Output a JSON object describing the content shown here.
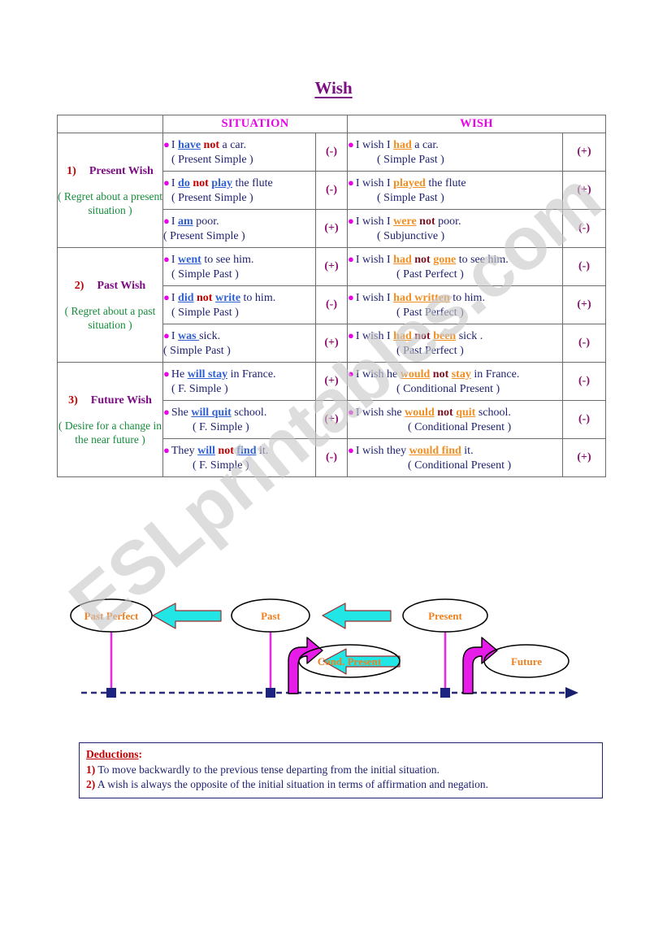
{
  "title": "Wish",
  "watermark": "ESLprintables.com",
  "table": {
    "headers": {
      "blank": "",
      "situation": "SITUATION",
      "wish": "WISH"
    },
    "sections": [
      {
        "num": "1)",
        "name": "Present Wish",
        "desc": "( Regret about a present situation )",
        "rows": [
          {
            "situation": {
              "pre": "I ",
              "verb": "have",
              "mid": " ",
              "neg": "not",
              "post": " a car."
            },
            "situation_tense": "( Present Simple )",
            "situation_sign": "(-)",
            "wish": {
              "pre": "I wish I ",
              "verb": "had",
              "mid": "",
              "neg": "",
              "post": " a car."
            },
            "wish_tense": "( Simple Past )",
            "wish_sign": "(+)"
          },
          {
            "situation": {
              "pre": "I ",
              "verb": "do",
              "mid": " ",
              "neg": "not",
              "post": " ",
              "verb2": "play",
              "post2": " the flute"
            },
            "situation_tense": "( Present Simple )",
            "situation_sign": "(-)",
            "wish": {
              "pre": "I wish I ",
              "verb": "played",
              "mid": "",
              "neg": "",
              "post": " the flute"
            },
            "wish_tense": "( Simple Past )",
            "wish_sign": "(+)"
          },
          {
            "situation": {
              "pre": "I ",
              "verb": "am",
              "mid": "",
              "neg": "",
              "post": " poor."
            },
            "situation_tense": "( Present Simple )",
            "situation_sign": "(+)",
            "wish": {
              "pre": "I wish I ",
              "verb": "were",
              "mid": " ",
              "neg": "not",
              "post": " poor."
            },
            "wish_tense": "( Subjunctive )",
            "wish_sign": "(-)"
          }
        ]
      },
      {
        "num": "2)",
        "name": "Past Wish",
        "desc": "( Regret about a past situation )",
        "rows": [
          {
            "situation": {
              "pre": "I ",
              "verb": "went",
              "mid": "",
              "neg": "",
              "post": " to see him."
            },
            "situation_tense": "( Simple Past )",
            "situation_sign": "(+)",
            "wish": {
              "pre": "I wish I ",
              "verb": "had",
              "mid": " ",
              "neg": "not",
              "post": " ",
              "verb2": "gone",
              "post2": " to see him."
            },
            "wish_tense": "( Past Perfect )",
            "wish_sign": "(-)"
          },
          {
            "situation": {
              "pre": "I ",
              "verb": "did",
              "mid": " ",
              "neg": "not",
              "post": " ",
              "verb2": "write",
              "post2": " to him."
            },
            "situation_tense": "( Simple Past )",
            "situation_sign": "(-)",
            "wish": {
              "pre": "I wish I ",
              "verb": "had written",
              "mid": "",
              "neg": "",
              "post": " to him."
            },
            "wish_tense": "( Past Perfect )",
            "wish_sign": "(+)"
          },
          {
            "situation": {
              "pre": "I ",
              "verb": "was ",
              "mid": "",
              "neg": "",
              "post": "sick."
            },
            "situation_tense": "( Simple Past )",
            "situation_sign": "(+)",
            "wish": {
              "pre": "I wish I ",
              "verb": "had",
              "mid": " ",
              "neg": "not",
              "post": " ",
              "verb2": "been",
              "post2": " sick ."
            },
            "wish_tense": "( Past Perfect )",
            "wish_sign": "(-)"
          }
        ]
      },
      {
        "num": "3)",
        "name": "Future Wish",
        "desc": "( Desire for a change in the near future )",
        "rows": [
          {
            "situation": {
              "pre": "He ",
              "verb": "will stay",
              "mid": "",
              "neg": "",
              "post": " in France."
            },
            "situation_tense": "( F. Simple )",
            "situation_sign": "(+)",
            "wish": {
              "pre": "I wish he ",
              "verb": "would",
              "mid": " ",
              "neg": "not",
              "post": " ",
              "verb2": "stay",
              "post2": " in France."
            },
            "wish_tense": "( Conditional Present )",
            "wish_sign": "(-)"
          },
          {
            "situation": {
              "pre": "She ",
              "verb": "will quit",
              "mid": "",
              "neg": "",
              "post": " school."
            },
            "situation_tense": "( F. Simple )",
            "situation_sign": "(+)",
            "wish": {
              "pre": "I wish she ",
              "verb": "would",
              "mid": " ",
              "neg": "not",
              "post": " ",
              "verb2": "quit",
              "post2": " school."
            },
            "wish_tense": "( Conditional Present )",
            "wish_sign": "(-)"
          },
          {
            "situation": {
              "pre": "They ",
              "verb": "will",
              "mid": " ",
              "neg": "not",
              "post": " ",
              "verb2": "find",
              "post2": " it."
            },
            "situation_tense": "( F. Simple )",
            "situation_sign": "(-)",
            "wish": {
              "pre": "I wish they ",
              "verb": "would find",
              "mid": "",
              "neg": "",
              "post": " it."
            },
            "wish_tense": "( Conditional Present )",
            "wish_sign": "(+)"
          }
        ]
      }
    ]
  },
  "diagram": {
    "nodes": [
      {
        "label": "Past Perfect"
      },
      {
        "label": "Past"
      },
      {
        "label": "Cond. Present"
      },
      {
        "label": "Present"
      },
      {
        "label": "Future"
      }
    ]
  },
  "deductions": {
    "title": "Deductions",
    "colon": ":",
    "items": [
      {
        "num": "1)",
        "text": " To move backwardly to the previous tense departing from the initial situation."
      },
      {
        "num": "2)",
        "text": " A wish is always the opposite of the initial situation in terms of affirmation and negation."
      }
    ]
  }
}
